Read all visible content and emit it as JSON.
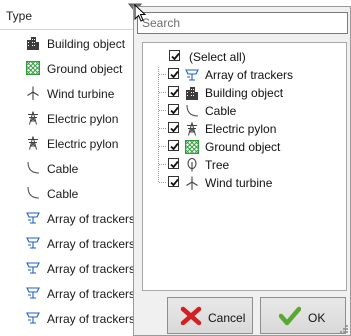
{
  "column": {
    "title": "Type"
  },
  "rows": [
    {
      "icon": "building-icon",
      "label": "Building object"
    },
    {
      "icon": "ground-object-icon",
      "label": "Ground object"
    },
    {
      "icon": "wind-turbine-icon",
      "label": "Wind turbine"
    },
    {
      "icon": "electric-pylon-icon",
      "label": "Electric pylon"
    },
    {
      "icon": "electric-pylon-icon",
      "label": "Electric pylon"
    },
    {
      "icon": "cable-icon",
      "label": "Cable"
    },
    {
      "icon": "cable-icon",
      "label": "Cable"
    },
    {
      "icon": "tracker-array-icon",
      "label": "Array of trackers"
    },
    {
      "icon": "tracker-array-icon",
      "label": "Array of trackers"
    },
    {
      "icon": "tracker-array-icon",
      "label": "Array of trackers"
    },
    {
      "icon": "tracker-array-icon",
      "label": "Array of trackers"
    },
    {
      "icon": "tracker-array-icon",
      "label": "Array of trackers"
    }
  ],
  "filter": {
    "search_placeholder": "Search",
    "select_all": {
      "label": "(Select all)",
      "checked": true
    },
    "items": [
      {
        "icon": "tracker-array-icon",
        "label": "Array of trackers",
        "checked": true
      },
      {
        "icon": "building-icon",
        "label": "Building object",
        "checked": true
      },
      {
        "icon": "cable-icon",
        "label": "Cable",
        "checked": true
      },
      {
        "icon": "electric-pylon-icon",
        "label": "Electric pylon",
        "checked": true
      },
      {
        "icon": "ground-object-icon",
        "label": "Ground object",
        "checked": true
      },
      {
        "icon": "tree-icon",
        "label": "Tree",
        "checked": true
      },
      {
        "icon": "wind-turbine-icon",
        "label": "Wind turbine",
        "checked": true
      }
    ],
    "cancel_label": "Cancel",
    "ok_label": "OK"
  },
  "colors": {
    "accent_blue": "#1f5fbf",
    "ground_green": "#2e9d3a",
    "cancel_red": "#d21f1f",
    "ok_green": "#5aa832"
  }
}
